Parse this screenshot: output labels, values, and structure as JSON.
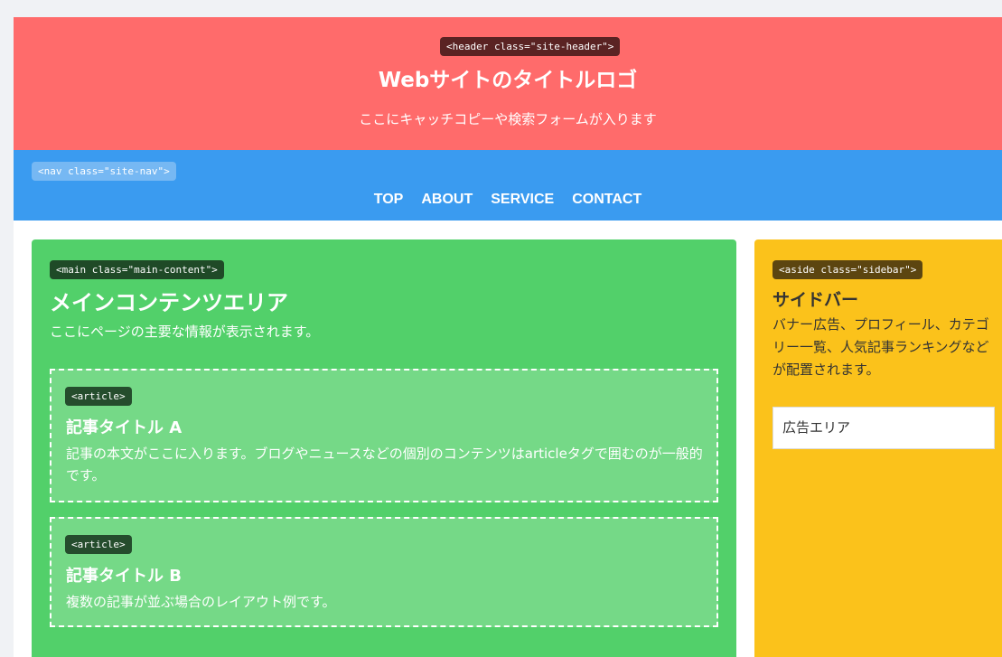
{
  "header": {
    "tag": "<header class=\"site-header\">",
    "title": "Webサイトのタイトルロゴ",
    "tagline": "ここにキャッチコピーや検索フォームが入ります"
  },
  "nav": {
    "tag": "<nav class=\"site-nav\">",
    "items": [
      {
        "label": "TOP"
      },
      {
        "label": "ABOUT"
      },
      {
        "label": "SERVICE"
      },
      {
        "label": "CONTACT"
      }
    ]
  },
  "main": {
    "tag": "<main class=\"main-content\">",
    "title": "メインコンテンツエリア",
    "description": "ここにページの主要な情報が表示されます。",
    "articles": [
      {
        "tag": "<article>",
        "title": "記事タイトル A",
        "body": "記事の本文がここに入ります。ブログやニュースなどの個別のコンテンツはarticleタグで囲むのが一般的です。"
      },
      {
        "tag": "<article>",
        "title": "記事タイトル B",
        "body": "複数の記事が並ぶ場合のレイアウト例です。"
      }
    ]
  },
  "sidebar": {
    "tag": "<aside class=\"sidebar\">",
    "title": "サイドバー",
    "description": "バナー広告、プロフィール、カテゴリー一覧、人気記事ランキングなどが配置されます。",
    "ad_label": "広告エリア"
  },
  "colors": {
    "header": "#ff6b6b",
    "nav": "#3a9bf0",
    "main": "#52d06a",
    "article": "#75d987",
    "sidebar": "#fbc21b"
  }
}
